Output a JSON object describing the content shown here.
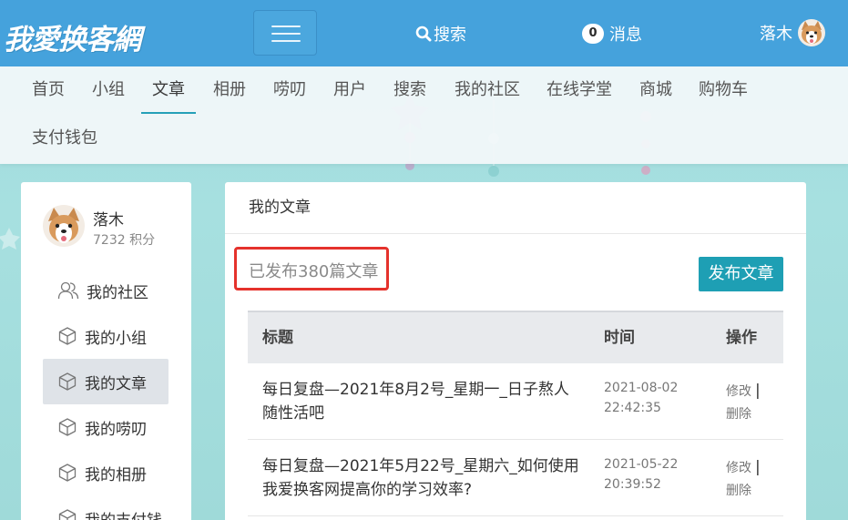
{
  "header": {
    "logo_text": "我愛换客網",
    "search_label": "搜索",
    "messages_count": "0",
    "messages_label": "消息",
    "username": "落木"
  },
  "nav": {
    "items": [
      "首页",
      "小组",
      "文章",
      "相册",
      "唠叨",
      "用户",
      "搜索",
      "我的社区",
      "在线学堂",
      "商城",
      "购物车",
      "支付钱包"
    ],
    "active": "文章"
  },
  "sidebar": {
    "profile": {
      "name": "落木",
      "points": "7232 积分"
    },
    "items": [
      {
        "label": "我的社区",
        "icon": "users-icon"
      },
      {
        "label": "我的小组",
        "icon": "cube-icon"
      },
      {
        "label": "我的文章",
        "icon": "cube-icon"
      },
      {
        "label": "我的唠叨",
        "icon": "cube-icon"
      },
      {
        "label": "我的相册",
        "icon": "cube-icon"
      },
      {
        "label": "我的支付钱",
        "icon": "cube-icon"
      }
    ],
    "active": "我的文章"
  },
  "panel": {
    "title": "我的文章",
    "published_count_text": "已发布380篇文章",
    "publish_button": "发布文章",
    "table": {
      "headers": {
        "title": "标题",
        "time": "时间",
        "actions": "操作"
      },
      "rows": [
        {
          "title": "每日复盘—2021年8月2号_星期一_日子熬人随性活吧",
          "date": "2021-08-02",
          "time": "22:42:35",
          "edit": "修改",
          "delete": "删除"
        },
        {
          "title": "每日复盘—2021年5月22号_星期六_如何使用我爱换客网提高你的学习效率?",
          "date": "2021-05-22",
          "time": "20:39:52",
          "edit": "修改",
          "delete": "删除"
        }
      ]
    }
  },
  "colors": {
    "header_bg": "#45a2dc",
    "accent": "#1e9fb4",
    "highlight_box": "#e5322c"
  }
}
